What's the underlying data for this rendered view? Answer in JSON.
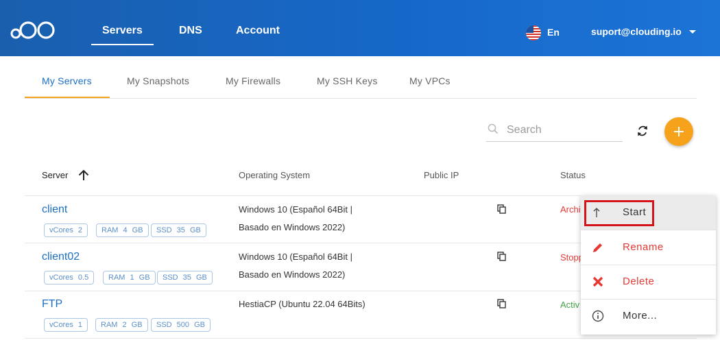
{
  "header": {
    "nav": [
      {
        "label": "Servers",
        "active": true
      },
      {
        "label": "DNS"
      },
      {
        "label": "Account"
      }
    ],
    "language": "En",
    "user_email": "suport@clouding.io",
    "brand_color": "#1a66c4"
  },
  "tabs": [
    {
      "label": "My Servers",
      "active": true
    },
    {
      "label": "My Snapshots"
    },
    {
      "label": "My Firewalls"
    },
    {
      "label": "My SSH Keys"
    },
    {
      "label": "My VPCs"
    }
  ],
  "toolbar": {
    "search_placeholder": "Search",
    "refresh_icon": "refresh-icon",
    "add_icon": "plus-icon",
    "accent_color": "#f7a21b"
  },
  "table": {
    "columns": {
      "server": "Server",
      "os": "Operating System",
      "public_ip": "Public IP",
      "status": "Status"
    },
    "rows": [
      {
        "name": "client",
        "vcores": "vCores 2",
        "ram": "RAM 4 GB",
        "ssd": "SSD 35 GB",
        "os_line1": "Windows 10 (Español 64Bit |",
        "os_line2": "Basado en Windows 2022)",
        "public_ip": "",
        "status": "Archi",
        "status_color": "#e53935"
      },
      {
        "name": "client02",
        "vcores": "vCores 0.5",
        "ram": "RAM 1 GB",
        "ssd": "SSD 35 GB",
        "os_line1": "Windows 10 (Español 64Bit |",
        "os_line2": "Basado en Windows 2022)",
        "public_ip": "",
        "status": "Stopp",
        "status_color": "#e53935"
      },
      {
        "name": "FTP",
        "vcores": "vCores 1",
        "ram": "RAM 2 GB",
        "ssd": "SSD 500 GB",
        "os_line1": "HestiaCP (Ubuntu 22.04 64Bits)",
        "os_line2": "",
        "public_ip": "",
        "status": "Activ",
        "status_color": "#43a047"
      }
    ]
  },
  "context_menu": {
    "items": [
      {
        "label": "Start",
        "icon": "arrow-up-icon",
        "color": "#333333",
        "highlighted": true
      },
      {
        "label": "Rename",
        "icon": "pencil-icon",
        "color": "#e53935"
      },
      {
        "label": "Delete",
        "icon": "x-icon",
        "color": "#e53935"
      },
      {
        "label": "More...",
        "icon": "info-icon",
        "color": "#333333"
      }
    ]
  }
}
